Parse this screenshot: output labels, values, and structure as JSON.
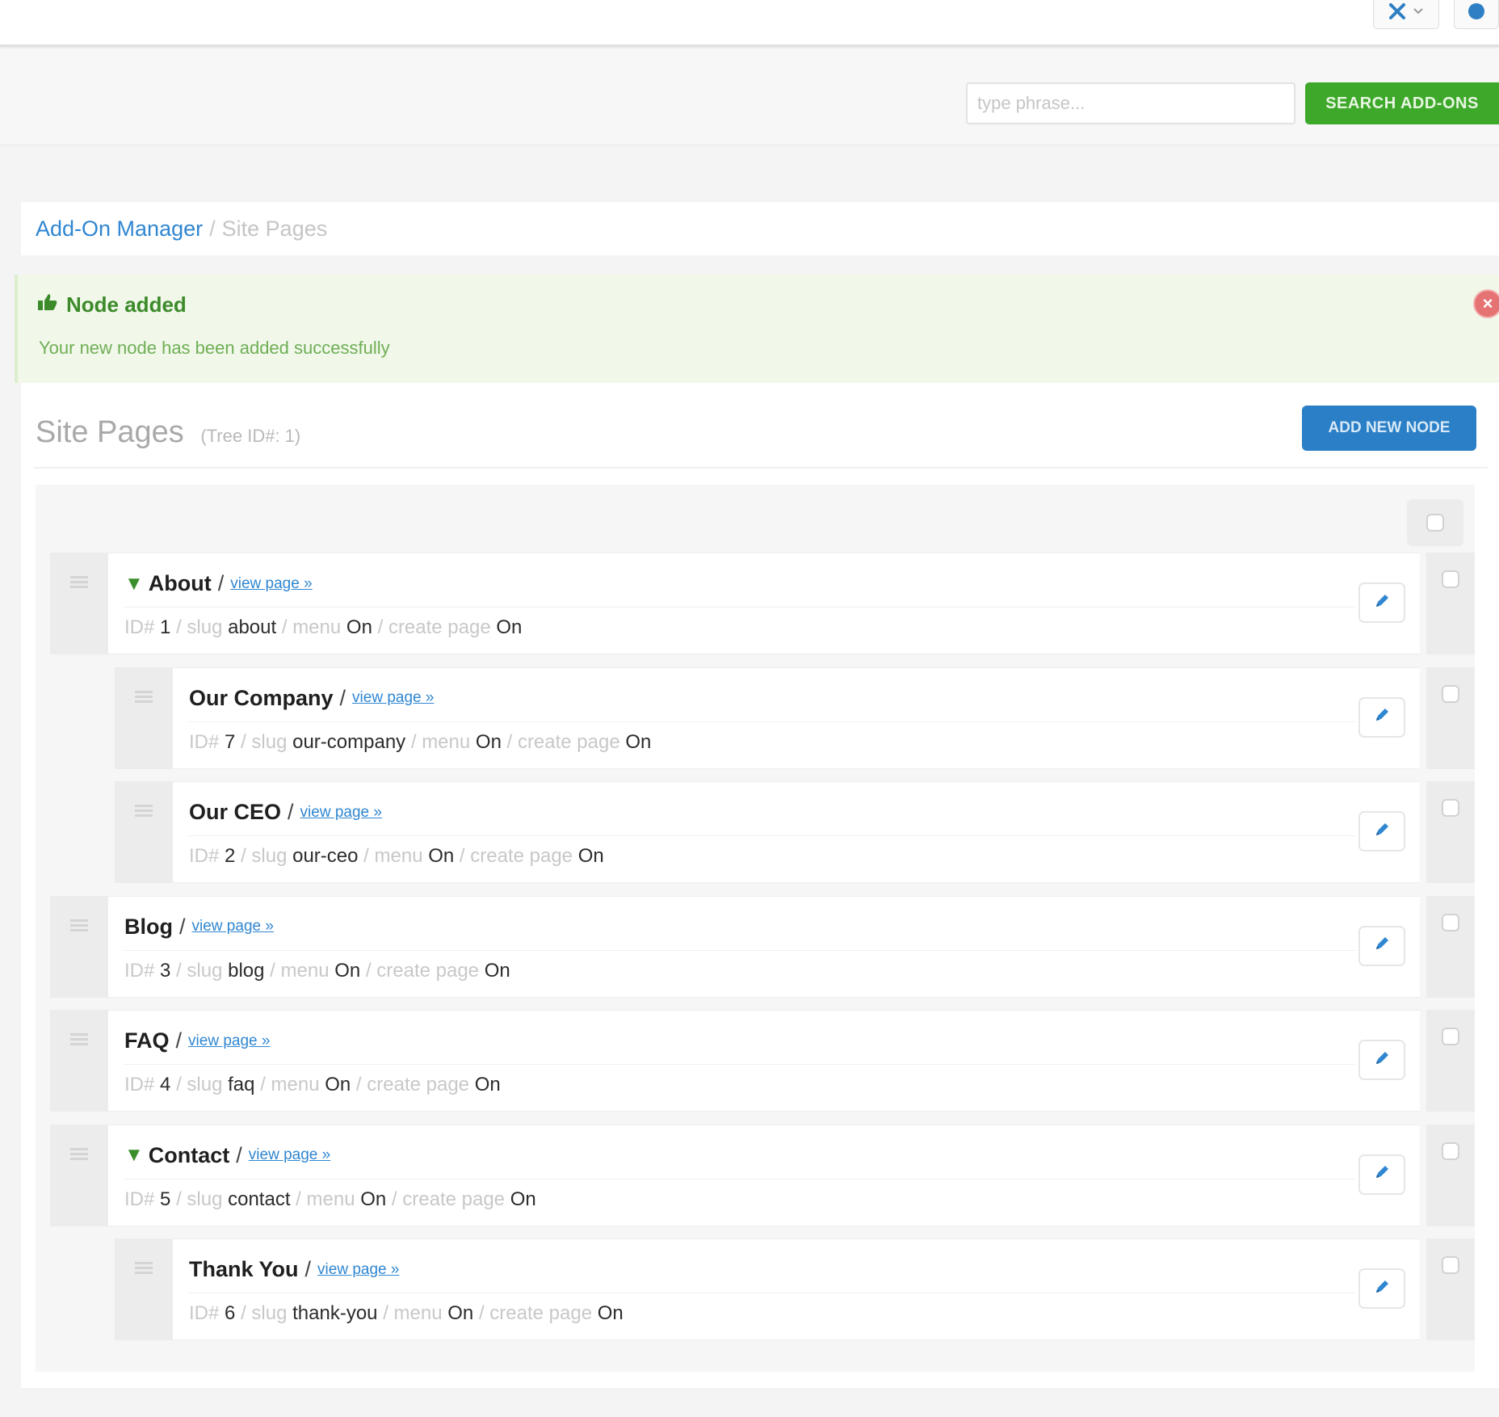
{
  "topbar": {
    "nav_icon": "navigation-tools-icon",
    "nav_dropdown_icon": "chevron-down-icon",
    "help_icon": "help-circle-icon"
  },
  "search": {
    "placeholder": "type phrase...",
    "button_label": "SEARCH ADD-ONS"
  },
  "breadcrumb": {
    "parent": "Add-On Manager",
    "separator": "/",
    "current": "Site Pages"
  },
  "alert": {
    "title": "Node added",
    "message": "Your new node has been added successfully",
    "icon": "thumbs-up-icon",
    "close_icon": "close-icon",
    "colors": {
      "background": "#f1f8ea",
      "title": "#3c8a2a",
      "close": "#e57373"
    }
  },
  "panel": {
    "title": "Site Pages",
    "subtitle": "(Tree ID#: 1)",
    "add_button_label": "ADD NEW NODE"
  },
  "nodes": [
    {
      "name": "About",
      "view_label": "view page »",
      "id": "1",
      "slug": "about",
      "menu": "On",
      "create_page": "On",
      "expanded": true,
      "level": 0
    },
    {
      "name": "Our Company",
      "view_label": "view page »",
      "id": "7",
      "slug": "our-company",
      "menu": "On",
      "create_page": "On",
      "expanded": false,
      "level": 1
    },
    {
      "name": "Our CEO",
      "view_label": "view page »",
      "id": "2",
      "slug": "our-ceo",
      "menu": "On",
      "create_page": "On",
      "expanded": false,
      "level": 1
    },
    {
      "name": "Blog",
      "view_label": "view page »",
      "id": "3",
      "slug": "blog",
      "menu": "On",
      "create_page": "On",
      "expanded": false,
      "level": 0
    },
    {
      "name": "FAQ",
      "view_label": "view page »",
      "id": "4",
      "slug": "faq",
      "menu": "On",
      "create_page": "On",
      "expanded": false,
      "level": 0
    },
    {
      "name": "Contact",
      "view_label": "view page »",
      "id": "5",
      "slug": "contact",
      "menu": "On",
      "create_page": "On",
      "expanded": true,
      "level": 0
    },
    {
      "name": "Thank You",
      "view_label": "view page »",
      "id": "6",
      "slug": "thank-you",
      "menu": "On",
      "create_page": "On",
      "expanded": false,
      "level": 1
    }
  ],
  "meta_labels": {
    "id": "ID#",
    "slug": "slug",
    "menu": "menu",
    "create_page": "create page",
    "separator": "/"
  },
  "expand_glyph": "▼",
  "colors": {
    "search_button": "#3ea82a",
    "add_button": "#2a7fc6",
    "link": "#2f86d1"
  }
}
